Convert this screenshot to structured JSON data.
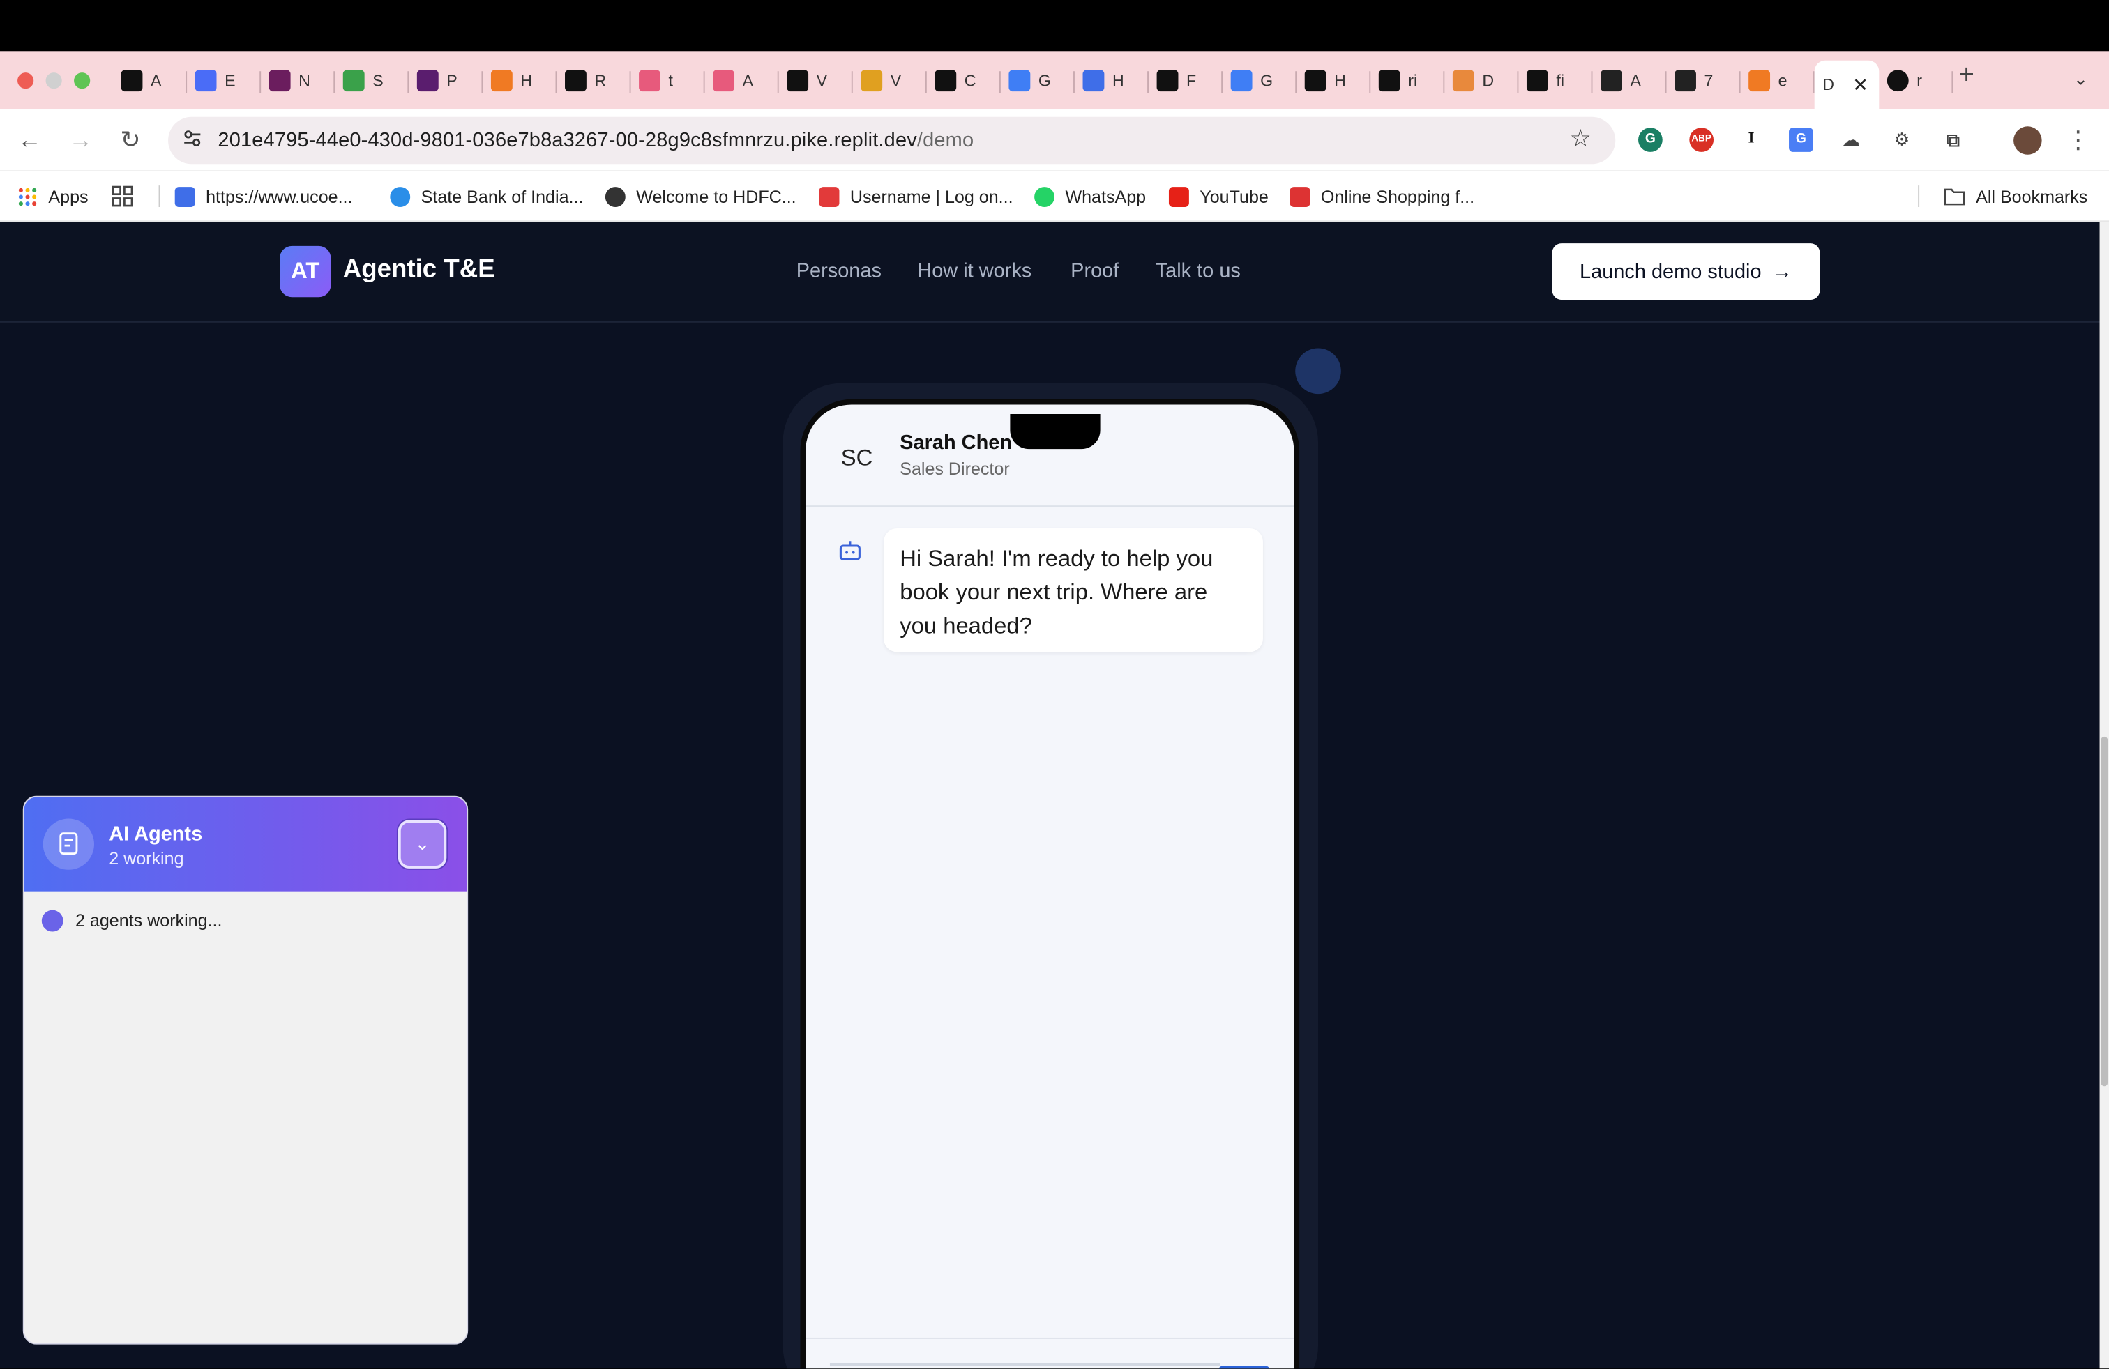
{
  "browser": {
    "tabs": [
      {
        "title": "A",
        "color": "#111111"
      },
      {
        "title": "E",
        "color": "#4a6cf7"
      },
      {
        "title": "N",
        "color": "#6b1d5e"
      },
      {
        "title": "S",
        "color": "#3aa14a"
      },
      {
        "title": "P",
        "color": "#5a1d6e"
      },
      {
        "title": "H",
        "color": "#f07a23"
      },
      {
        "title": "R",
        "color": "#111111"
      },
      {
        "title": "t",
        "color": "#e75a7c"
      },
      {
        "title": "A",
        "color": "#e75a7c"
      },
      {
        "title": "V",
        "color": "#111111"
      },
      {
        "title": "V",
        "color": "#e0a020"
      },
      {
        "title": "C",
        "color": "#111111"
      },
      {
        "title": "G",
        "color": "#3f7ef5"
      },
      {
        "title": "H",
        "color": "#3f6ee8"
      },
      {
        "title": "F",
        "color": "#111111"
      },
      {
        "title": "G",
        "color": "#3f7ef5"
      },
      {
        "title": "H",
        "color": "#111111"
      },
      {
        "title": "ri",
        "color": "#111111"
      },
      {
        "title": "D",
        "color": "#e8893c"
      },
      {
        "title": "fi",
        "color": "#111111"
      },
      {
        "title": "A",
        "color": "#222222"
      },
      {
        "title": "7",
        "color": "#222222"
      },
      {
        "title": "e",
        "color": "#f07a23"
      }
    ],
    "active_tab": {
      "title": "D"
    },
    "last_tab": {
      "title": "r"
    },
    "url_host": "201e4795-44e0-430d-9801-036e7b8a3267-00-28g9c8sfmnrzu.pike.replit.dev",
    "url_path": "/demo",
    "bookmarks": [
      {
        "label": "Apps",
        "color": "#e84335"
      },
      {
        "label": "https://www.ucoe...",
        "color": "#3f6ee8"
      },
      {
        "label": "State Bank of India...",
        "color": "#2a8ee8"
      },
      {
        "label": "Welcome to HDFC...",
        "color": "#333333"
      },
      {
        "label": "Username | Log on...",
        "color": "#e23a3a"
      },
      {
        "label": "WhatsApp",
        "color": "#25d366"
      },
      {
        "label": "YouTube",
        "color": "#e62117"
      },
      {
        "label": "Online Shopping f...",
        "color": "#d33"
      }
    ],
    "all_bookmarks": "All Bookmarks"
  },
  "site": {
    "logo_initials": "AT",
    "brand": "Agentic T&E",
    "nav_links": [
      "Personas",
      "How it works",
      "Proof",
      "Talk to us"
    ],
    "cta_label": "Launch demo studio",
    "cta_arrow": "→"
  },
  "chat": {
    "avatar_initials": "SC",
    "name": "Sarah Chen",
    "role": "Sales Director",
    "bot_message": "Hi Sarah! I'm ready to help you book your next trip. Where are you headed?"
  },
  "agents_panel": {
    "title": "AI Agents",
    "subtitle": "2 working",
    "status": "2 agents working...",
    "collapse_icon": "⌄"
  }
}
